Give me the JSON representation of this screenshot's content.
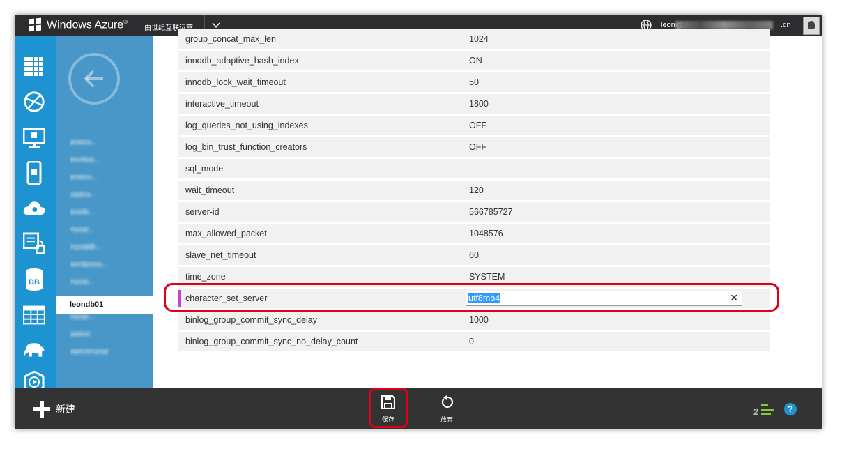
{
  "topbar": {
    "brand": "Windows Azure",
    "brand_mark": "®",
    "subscription": "由世纪互联运营",
    "account": "leon@",
    "account_suffix": ".cn"
  },
  "subnav": {
    "items": [
      "jenkins...",
      "leonfast...",
      "jenkins...",
      "replica...",
      "testdb...",
      "mysql...",
      "mysqldb...",
      "wordpress...",
      "mysql..."
    ],
    "selected": "leondb01",
    "items_after": [
      "mysql...",
      "wptest",
      "wptestmysql"
    ]
  },
  "params": [
    {
      "key": "group_concat_max_len",
      "value": "1024"
    },
    {
      "key": "innodb_adaptive_hash_index",
      "value": "ON"
    },
    {
      "key": "innodb_lock_wait_timeout",
      "value": "50"
    },
    {
      "key": "interactive_timeout",
      "value": "1800"
    },
    {
      "key": "log_queries_not_using_indexes",
      "value": "OFF"
    },
    {
      "key": "log_bin_trust_function_creators",
      "value": "OFF"
    },
    {
      "key": "sql_mode",
      "value": ""
    },
    {
      "key": "wait_timeout",
      "value": "120"
    },
    {
      "key": "server-id",
      "value": "566785727"
    },
    {
      "key": "max_allowed_packet",
      "value": "1048576"
    },
    {
      "key": "slave_net_timeout",
      "value": "60"
    },
    {
      "key": "time_zone",
      "value": "SYSTEM"
    }
  ],
  "edit_row": {
    "key": "character_set_server",
    "value": "utf8mb4"
  },
  "params_after": [
    {
      "key": "binlog_group_commit_sync_delay",
      "value": "1000"
    },
    {
      "key": "binlog_group_commit_sync_no_delay_count",
      "value": "0"
    }
  ],
  "bottombar": {
    "new_label": "新建",
    "save_label": "保存",
    "discard_label": "放弃",
    "notification_count": "2",
    "help": "?"
  },
  "colors": {
    "rail": "#1d94d1",
    "subnav": "#4897c8",
    "topbar": "#2d2d30",
    "bottombar": "#333333",
    "highlight": "#e0001b",
    "edit_marker": "#c545c5"
  }
}
